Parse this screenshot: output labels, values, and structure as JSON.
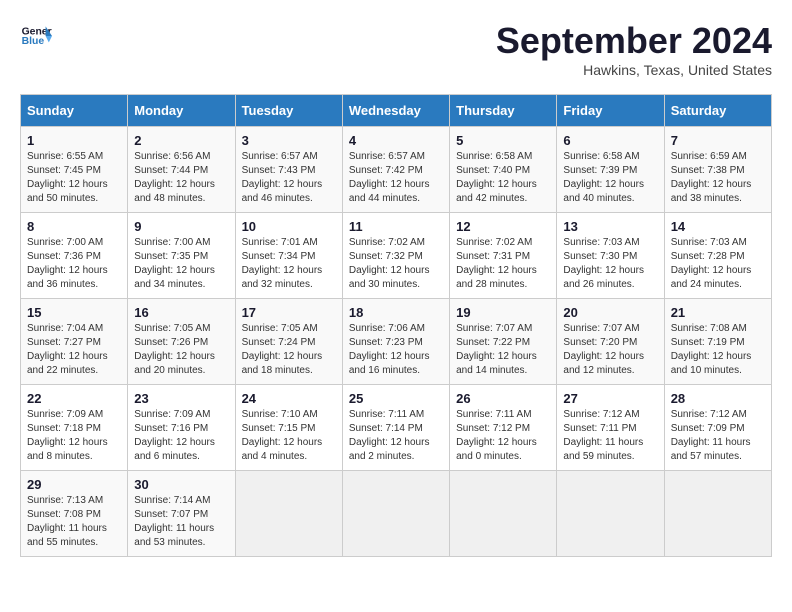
{
  "header": {
    "logo_line1": "General",
    "logo_line2": "Blue",
    "title": "September 2024",
    "location": "Hawkins, Texas, United States"
  },
  "weekdays": [
    "Sunday",
    "Monday",
    "Tuesday",
    "Wednesday",
    "Thursday",
    "Friday",
    "Saturday"
  ],
  "weeks": [
    [
      {
        "day": "1",
        "sunrise": "Sunrise: 6:55 AM",
        "sunset": "Sunset: 7:45 PM",
        "daylight": "Daylight: 12 hours and 50 minutes."
      },
      {
        "day": "2",
        "sunrise": "Sunrise: 6:56 AM",
        "sunset": "Sunset: 7:44 PM",
        "daylight": "Daylight: 12 hours and 48 minutes."
      },
      {
        "day": "3",
        "sunrise": "Sunrise: 6:57 AM",
        "sunset": "Sunset: 7:43 PM",
        "daylight": "Daylight: 12 hours and 46 minutes."
      },
      {
        "day": "4",
        "sunrise": "Sunrise: 6:57 AM",
        "sunset": "Sunset: 7:42 PM",
        "daylight": "Daylight: 12 hours and 44 minutes."
      },
      {
        "day": "5",
        "sunrise": "Sunrise: 6:58 AM",
        "sunset": "Sunset: 7:40 PM",
        "daylight": "Daylight: 12 hours and 42 minutes."
      },
      {
        "day": "6",
        "sunrise": "Sunrise: 6:58 AM",
        "sunset": "Sunset: 7:39 PM",
        "daylight": "Daylight: 12 hours and 40 minutes."
      },
      {
        "day": "7",
        "sunrise": "Sunrise: 6:59 AM",
        "sunset": "Sunset: 7:38 PM",
        "daylight": "Daylight: 12 hours and 38 minutes."
      }
    ],
    [
      {
        "day": "8",
        "sunrise": "Sunrise: 7:00 AM",
        "sunset": "Sunset: 7:36 PM",
        "daylight": "Daylight: 12 hours and 36 minutes."
      },
      {
        "day": "9",
        "sunrise": "Sunrise: 7:00 AM",
        "sunset": "Sunset: 7:35 PM",
        "daylight": "Daylight: 12 hours and 34 minutes."
      },
      {
        "day": "10",
        "sunrise": "Sunrise: 7:01 AM",
        "sunset": "Sunset: 7:34 PM",
        "daylight": "Daylight: 12 hours and 32 minutes."
      },
      {
        "day": "11",
        "sunrise": "Sunrise: 7:02 AM",
        "sunset": "Sunset: 7:32 PM",
        "daylight": "Daylight: 12 hours and 30 minutes."
      },
      {
        "day": "12",
        "sunrise": "Sunrise: 7:02 AM",
        "sunset": "Sunset: 7:31 PM",
        "daylight": "Daylight: 12 hours and 28 minutes."
      },
      {
        "day": "13",
        "sunrise": "Sunrise: 7:03 AM",
        "sunset": "Sunset: 7:30 PM",
        "daylight": "Daylight: 12 hours and 26 minutes."
      },
      {
        "day": "14",
        "sunrise": "Sunrise: 7:03 AM",
        "sunset": "Sunset: 7:28 PM",
        "daylight": "Daylight: 12 hours and 24 minutes."
      }
    ],
    [
      {
        "day": "15",
        "sunrise": "Sunrise: 7:04 AM",
        "sunset": "Sunset: 7:27 PM",
        "daylight": "Daylight: 12 hours and 22 minutes."
      },
      {
        "day": "16",
        "sunrise": "Sunrise: 7:05 AM",
        "sunset": "Sunset: 7:26 PM",
        "daylight": "Daylight: 12 hours and 20 minutes."
      },
      {
        "day": "17",
        "sunrise": "Sunrise: 7:05 AM",
        "sunset": "Sunset: 7:24 PM",
        "daylight": "Daylight: 12 hours and 18 minutes."
      },
      {
        "day": "18",
        "sunrise": "Sunrise: 7:06 AM",
        "sunset": "Sunset: 7:23 PM",
        "daylight": "Daylight: 12 hours and 16 minutes."
      },
      {
        "day": "19",
        "sunrise": "Sunrise: 7:07 AM",
        "sunset": "Sunset: 7:22 PM",
        "daylight": "Daylight: 12 hours and 14 minutes."
      },
      {
        "day": "20",
        "sunrise": "Sunrise: 7:07 AM",
        "sunset": "Sunset: 7:20 PM",
        "daylight": "Daylight: 12 hours and 12 minutes."
      },
      {
        "day": "21",
        "sunrise": "Sunrise: 7:08 AM",
        "sunset": "Sunset: 7:19 PM",
        "daylight": "Daylight: 12 hours and 10 minutes."
      }
    ],
    [
      {
        "day": "22",
        "sunrise": "Sunrise: 7:09 AM",
        "sunset": "Sunset: 7:18 PM",
        "daylight": "Daylight: 12 hours and 8 minutes."
      },
      {
        "day": "23",
        "sunrise": "Sunrise: 7:09 AM",
        "sunset": "Sunset: 7:16 PM",
        "daylight": "Daylight: 12 hours and 6 minutes."
      },
      {
        "day": "24",
        "sunrise": "Sunrise: 7:10 AM",
        "sunset": "Sunset: 7:15 PM",
        "daylight": "Daylight: 12 hours and 4 minutes."
      },
      {
        "day": "25",
        "sunrise": "Sunrise: 7:11 AM",
        "sunset": "Sunset: 7:14 PM",
        "daylight": "Daylight: 12 hours and 2 minutes."
      },
      {
        "day": "26",
        "sunrise": "Sunrise: 7:11 AM",
        "sunset": "Sunset: 7:12 PM",
        "daylight": "Daylight: 12 hours and 0 minutes."
      },
      {
        "day": "27",
        "sunrise": "Sunrise: 7:12 AM",
        "sunset": "Sunset: 7:11 PM",
        "daylight": "Daylight: 11 hours and 59 minutes."
      },
      {
        "day": "28",
        "sunrise": "Sunrise: 7:12 AM",
        "sunset": "Sunset: 7:09 PM",
        "daylight": "Daylight: 11 hours and 57 minutes."
      }
    ],
    [
      {
        "day": "29",
        "sunrise": "Sunrise: 7:13 AM",
        "sunset": "Sunset: 7:08 PM",
        "daylight": "Daylight: 11 hours and 55 minutes."
      },
      {
        "day": "30",
        "sunrise": "Sunrise: 7:14 AM",
        "sunset": "Sunset: 7:07 PM",
        "daylight": "Daylight: 11 hours and 53 minutes."
      },
      null,
      null,
      null,
      null,
      null
    ]
  ]
}
